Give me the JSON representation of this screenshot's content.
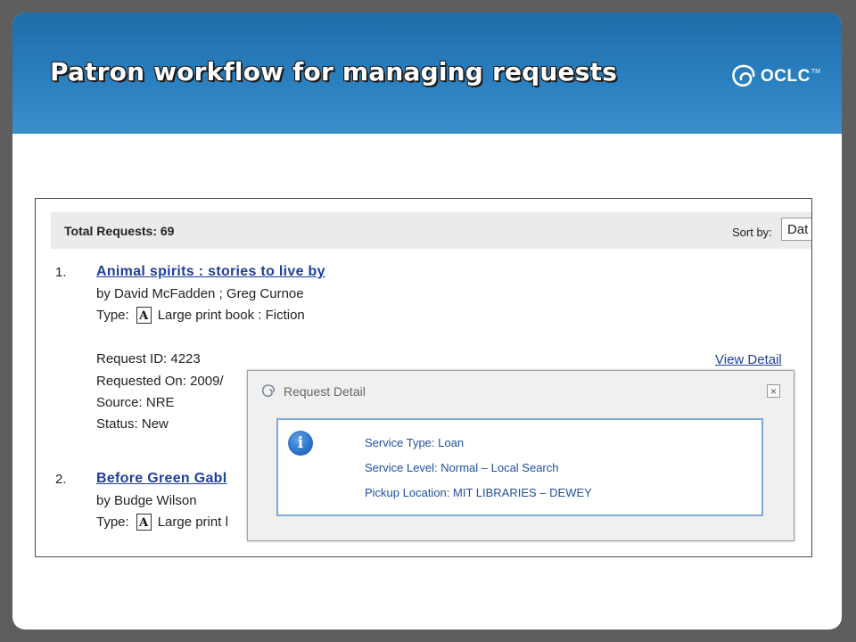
{
  "slide": {
    "title": "Patron workflow for managing requests",
    "logo_text": "OCLC",
    "logo_tm": "TM"
  },
  "list": {
    "total_label": "Total Requests: 69",
    "sort_label": "Sort by:",
    "sort_value": "Dat"
  },
  "items": [
    {
      "number": "1.",
      "title": "Animal spirits : stories to live by",
      "author": "by David McFadden ; Greg Curnoe",
      "type_label": "Type:",
      "type_icon": "large-print-icon",
      "type_value": "Large print book : Fiction",
      "request_id": "Request ID: 4223",
      "requested_on": "Requested On: 2009/",
      "source": "Source: NRE",
      "status": "Status: New",
      "view_detail": "View Detail"
    },
    {
      "number": "2.",
      "title": "Before Green Gabl",
      "author": "by Budge Wilson",
      "type_label": "Type:",
      "type_icon": "large-print-icon",
      "type_value": "Large print l"
    }
  ],
  "dialog": {
    "title": "Request Detail",
    "close": "×",
    "info_glyph": "i",
    "service_type": "Service Type: Loan",
    "service_level": "Service Level: Normal – Local Search",
    "pickup_location": "Pickup Location: MIT LIBRARIES – DEWEY"
  },
  "colors": {
    "header_blue": "#2a7fbf",
    "link_blue": "#1f3f9a",
    "dialog_border": "#7eaad6"
  }
}
